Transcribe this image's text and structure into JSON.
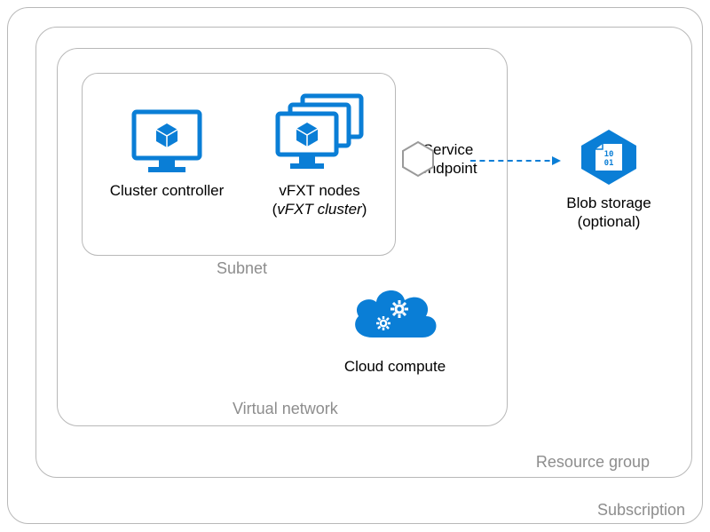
{
  "colors": {
    "azure_blue": "#0a7ed6",
    "label_grey": "#8d8d8d",
    "border_grey": "#b8b8b8"
  },
  "containers": {
    "subscription": {
      "label": "Subscription"
    },
    "resource_group": {
      "label": "Resource group"
    },
    "virtual_network": {
      "label": "Virtual network"
    },
    "subnet": {
      "label": "Subnet"
    }
  },
  "items": {
    "cluster_controller": {
      "label": "Cluster controller",
      "icon": "monitor-cube-icon"
    },
    "vfxt_nodes": {
      "label_line1": "vFXT nodes",
      "label_line2_pre": "(",
      "label_line2_italic": "vFXT cluster",
      "label_line2_post": ")",
      "icon": "monitor-cube-stack-icon"
    },
    "service_endpoint": {
      "label_line1": "Service",
      "label_line2": "endpoint",
      "icon": "hexagon-outline-icon"
    },
    "blob_storage": {
      "label_line1": "Blob storage",
      "label_line2": "(optional)",
      "icon": "blob-hexagon-icon"
    },
    "cloud_compute": {
      "label": "Cloud compute",
      "icon": "cloud-gears-icon"
    }
  },
  "connections": {
    "endpoint_to_blob": {
      "from": "service_endpoint",
      "to": "blob_storage",
      "style": "dashed-arrow"
    }
  }
}
